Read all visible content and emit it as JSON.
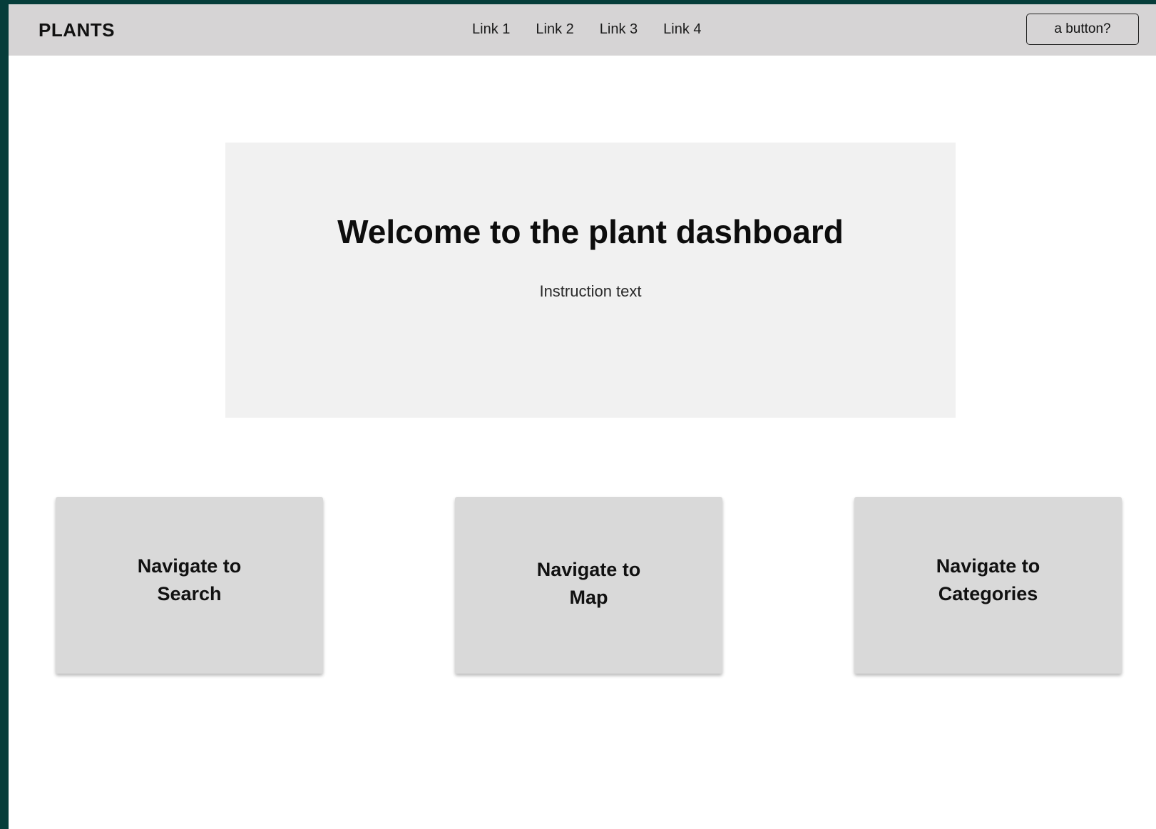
{
  "navbar": {
    "brand": "PLANTS",
    "links": [
      "Link 1",
      "Link 2",
      "Link 3",
      "Link 4"
    ],
    "button_label": "a button?"
  },
  "hero": {
    "title": "Welcome to the plant dashboard",
    "text": "Instruction text"
  },
  "cards": [
    {
      "line1": "Navigate to",
      "line2": "Search"
    },
    {
      "line1": "Navigate to",
      "line2": "Map"
    },
    {
      "line1": "Navigate to",
      "line2": "Categories"
    }
  ],
  "colors": {
    "frame": "#063d3a",
    "navbar": "#d6d4d5",
    "hero": "#f1f1f1",
    "card": "#d9d9d9"
  }
}
